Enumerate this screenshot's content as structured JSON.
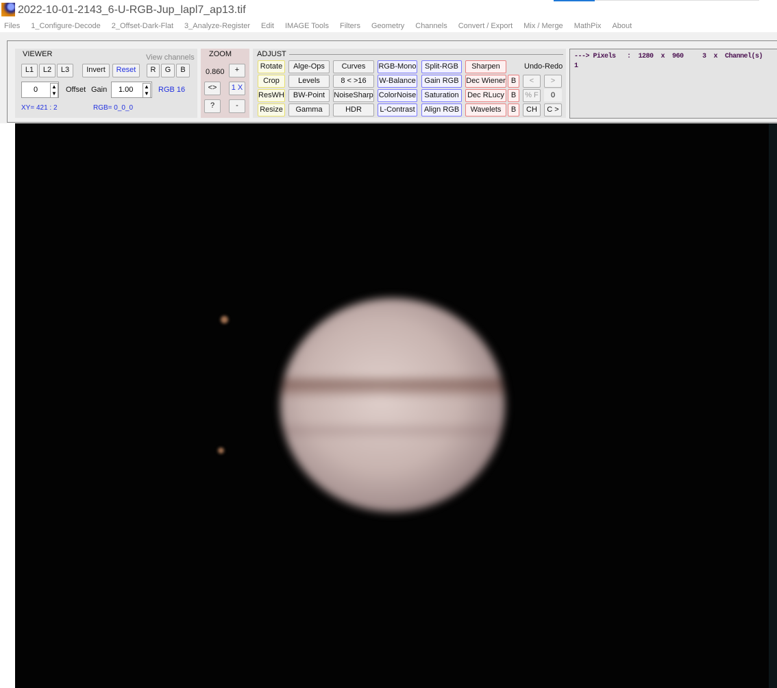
{
  "window": {
    "title": "2022-10-01-2143_6-U-RGB-Jup_lapl7_ap13.tif"
  },
  "menu": [
    "Files",
    "1_Configure-Decode",
    "2_Offset-Dark-Flat",
    "3_Analyze-Register",
    "Edit",
    "IMAGE Tools",
    "Filters",
    "Geometry",
    "Channels",
    "Convert / Export",
    "Mix / Merge",
    "MathPix",
    "About"
  ],
  "viewer": {
    "title": "VIEWER",
    "view_channels": "View channels",
    "l1": "L1",
    "l2": "L2",
    "l3": "L3",
    "invert": "Invert",
    "reset": "Reset",
    "r": "R",
    "g": "G",
    "b": "B",
    "offset_value": "0",
    "offset_label": "Offset",
    "gain_label": "Gain",
    "gain_value": "1.00",
    "rgb_mode": "RGB 16",
    "xy": "XY=  421 : 2",
    "rgb": "RGB=  0_0_0"
  },
  "zoom": {
    "title": "ZOOM",
    "value": "0.860",
    "plus": "+",
    "fit": "<>",
    "onex": "1 X",
    "help": "?",
    "minus": "-"
  },
  "adjust": {
    "title": "ADJUST",
    "col1": [
      "Rotate",
      "Crop",
      "ResWH",
      "Resize"
    ],
    "col2": [
      "Alge-Ops",
      "Levels",
      "BW-Point",
      "Gamma"
    ],
    "col3": [
      "Curves",
      "8 < >16",
      "NoiseSharp",
      "HDR"
    ],
    "col4": [
      "RGB-Mono",
      "W-Balance",
      "ColorNoise",
      "L-Contrast"
    ],
    "col5": [
      "Split-RGB",
      "Gain RGB",
      "Saturation",
      "Align RGB"
    ],
    "col6": [
      "Sharpen",
      "Dec Wiener",
      "Dec RLucy",
      "Wavelets"
    ],
    "b": "B",
    "undo_redo": "Undo-Redo",
    "undo": "<",
    "redo": ">",
    "percent_f": "% F",
    "counter": "0",
    "ch": "CH",
    "c_next": "C >"
  },
  "info": {
    "text": "---> Pixels   :  1280  x  960     3  x  Channel(s)     1"
  }
}
